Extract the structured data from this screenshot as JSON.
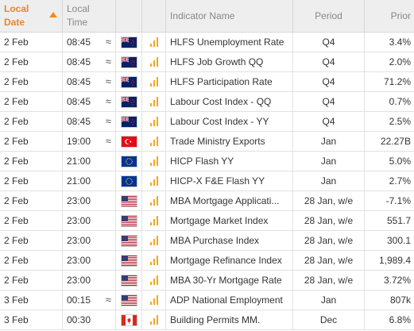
{
  "header": {
    "local_date": "Local Date",
    "local_time": "Local Time",
    "indicator_name": "Indicator Name",
    "period": "Period",
    "prior": "Prior"
  },
  "colors": {
    "accent": "#f08a24",
    "importance_bars": "#f5a623",
    "header_bg": "#eeeeee"
  },
  "rows": [
    {
      "date": "2 Feb",
      "time": "08:45",
      "approx": "≈",
      "flag": "NZ",
      "name": "HLFS Unemployment Rate",
      "period": "Q4",
      "prior": "3.4%"
    },
    {
      "date": "2 Feb",
      "time": "08:45",
      "approx": "≈",
      "flag": "NZ",
      "name": "HLFS Job Growth QQ",
      "period": "Q4",
      "prior": "2.0%"
    },
    {
      "date": "2 Feb",
      "time": "08:45",
      "approx": "≈",
      "flag": "NZ",
      "name": "HLFS Participation Rate",
      "period": "Q4",
      "prior": "71.2%"
    },
    {
      "date": "2 Feb",
      "time": "08:45",
      "approx": "≈",
      "flag": "NZ",
      "name": "Labour Cost Index - QQ",
      "period": "Q4",
      "prior": "0.7%"
    },
    {
      "date": "2 Feb",
      "time": "08:45",
      "approx": "≈",
      "flag": "NZ",
      "name": "Labour Cost Index - YY",
      "period": "Q4",
      "prior": "2.5%"
    },
    {
      "date": "2 Feb",
      "time": "19:00",
      "approx": "≈",
      "flag": "TR",
      "name": "Trade Ministry Exports",
      "period": "Jan",
      "prior": "22.27B"
    },
    {
      "date": "2 Feb",
      "time": "21:00",
      "approx": "",
      "flag": "EU",
      "name": "HICP Flash YY",
      "period": "Jan",
      "prior": "5.0%"
    },
    {
      "date": "2 Feb",
      "time": "21:00",
      "approx": "",
      "flag": "EU",
      "name": "HICP-X F&E Flash YY",
      "period": "Jan",
      "prior": "2.7%"
    },
    {
      "date": "2 Feb",
      "time": "23:00",
      "approx": "",
      "flag": "US",
      "name": "MBA Mortgage Applicati...",
      "period": "28 Jan, w/e",
      "prior": "-7.1%"
    },
    {
      "date": "2 Feb",
      "time": "23:00",
      "approx": "",
      "flag": "US",
      "name": "Mortgage Market Index",
      "period": "28 Jan, w/e",
      "prior": "551.7"
    },
    {
      "date": "2 Feb",
      "time": "23:00",
      "approx": "",
      "flag": "US",
      "name": "MBA Purchase Index",
      "period": "28 Jan, w/e",
      "prior": "300.1"
    },
    {
      "date": "2 Feb",
      "time": "23:00",
      "approx": "",
      "flag": "US",
      "name": "Mortgage Refinance Index",
      "period": "28 Jan, w/e",
      "prior": "1,989.4"
    },
    {
      "date": "2 Feb",
      "time": "23:00",
      "approx": "",
      "flag": "US",
      "name": "MBA 30-Yr Mortgage Rate",
      "period": "28 Jan, w/e",
      "prior": "3.72%"
    },
    {
      "date": "3 Feb",
      "time": "00:15",
      "approx": "≈",
      "flag": "US",
      "name": "ADP National Employment",
      "period": "Jan",
      "prior": "807k"
    },
    {
      "date": "3 Feb",
      "time": "00:30",
      "approx": "",
      "flag": "CA",
      "name": "Building Permits MM.",
      "period": "Dec",
      "prior": "6.8%"
    }
  ]
}
